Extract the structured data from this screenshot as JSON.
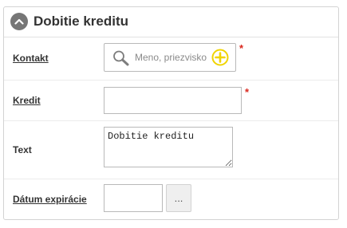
{
  "panel": {
    "title": "Dobitie kreditu",
    "collapse_icon": "chevron-up-icon"
  },
  "form": {
    "contact": {
      "label": "Kontakt",
      "placeholder": "Meno, priezvisko",
      "required_mark": "*",
      "search_icon": "search-icon",
      "add_icon": "plus-circle-icon"
    },
    "credit": {
      "label": "Kredit",
      "value": "",
      "required_mark": "*"
    },
    "text": {
      "label": "Text",
      "value": "Dobitie kreditu"
    },
    "expiry": {
      "label": "Dátum expirácie",
      "value": "",
      "picker_label": "..."
    }
  },
  "colors": {
    "required": "#d9261c",
    "add_button": "#f0d400",
    "collapse_button": "#767676"
  }
}
